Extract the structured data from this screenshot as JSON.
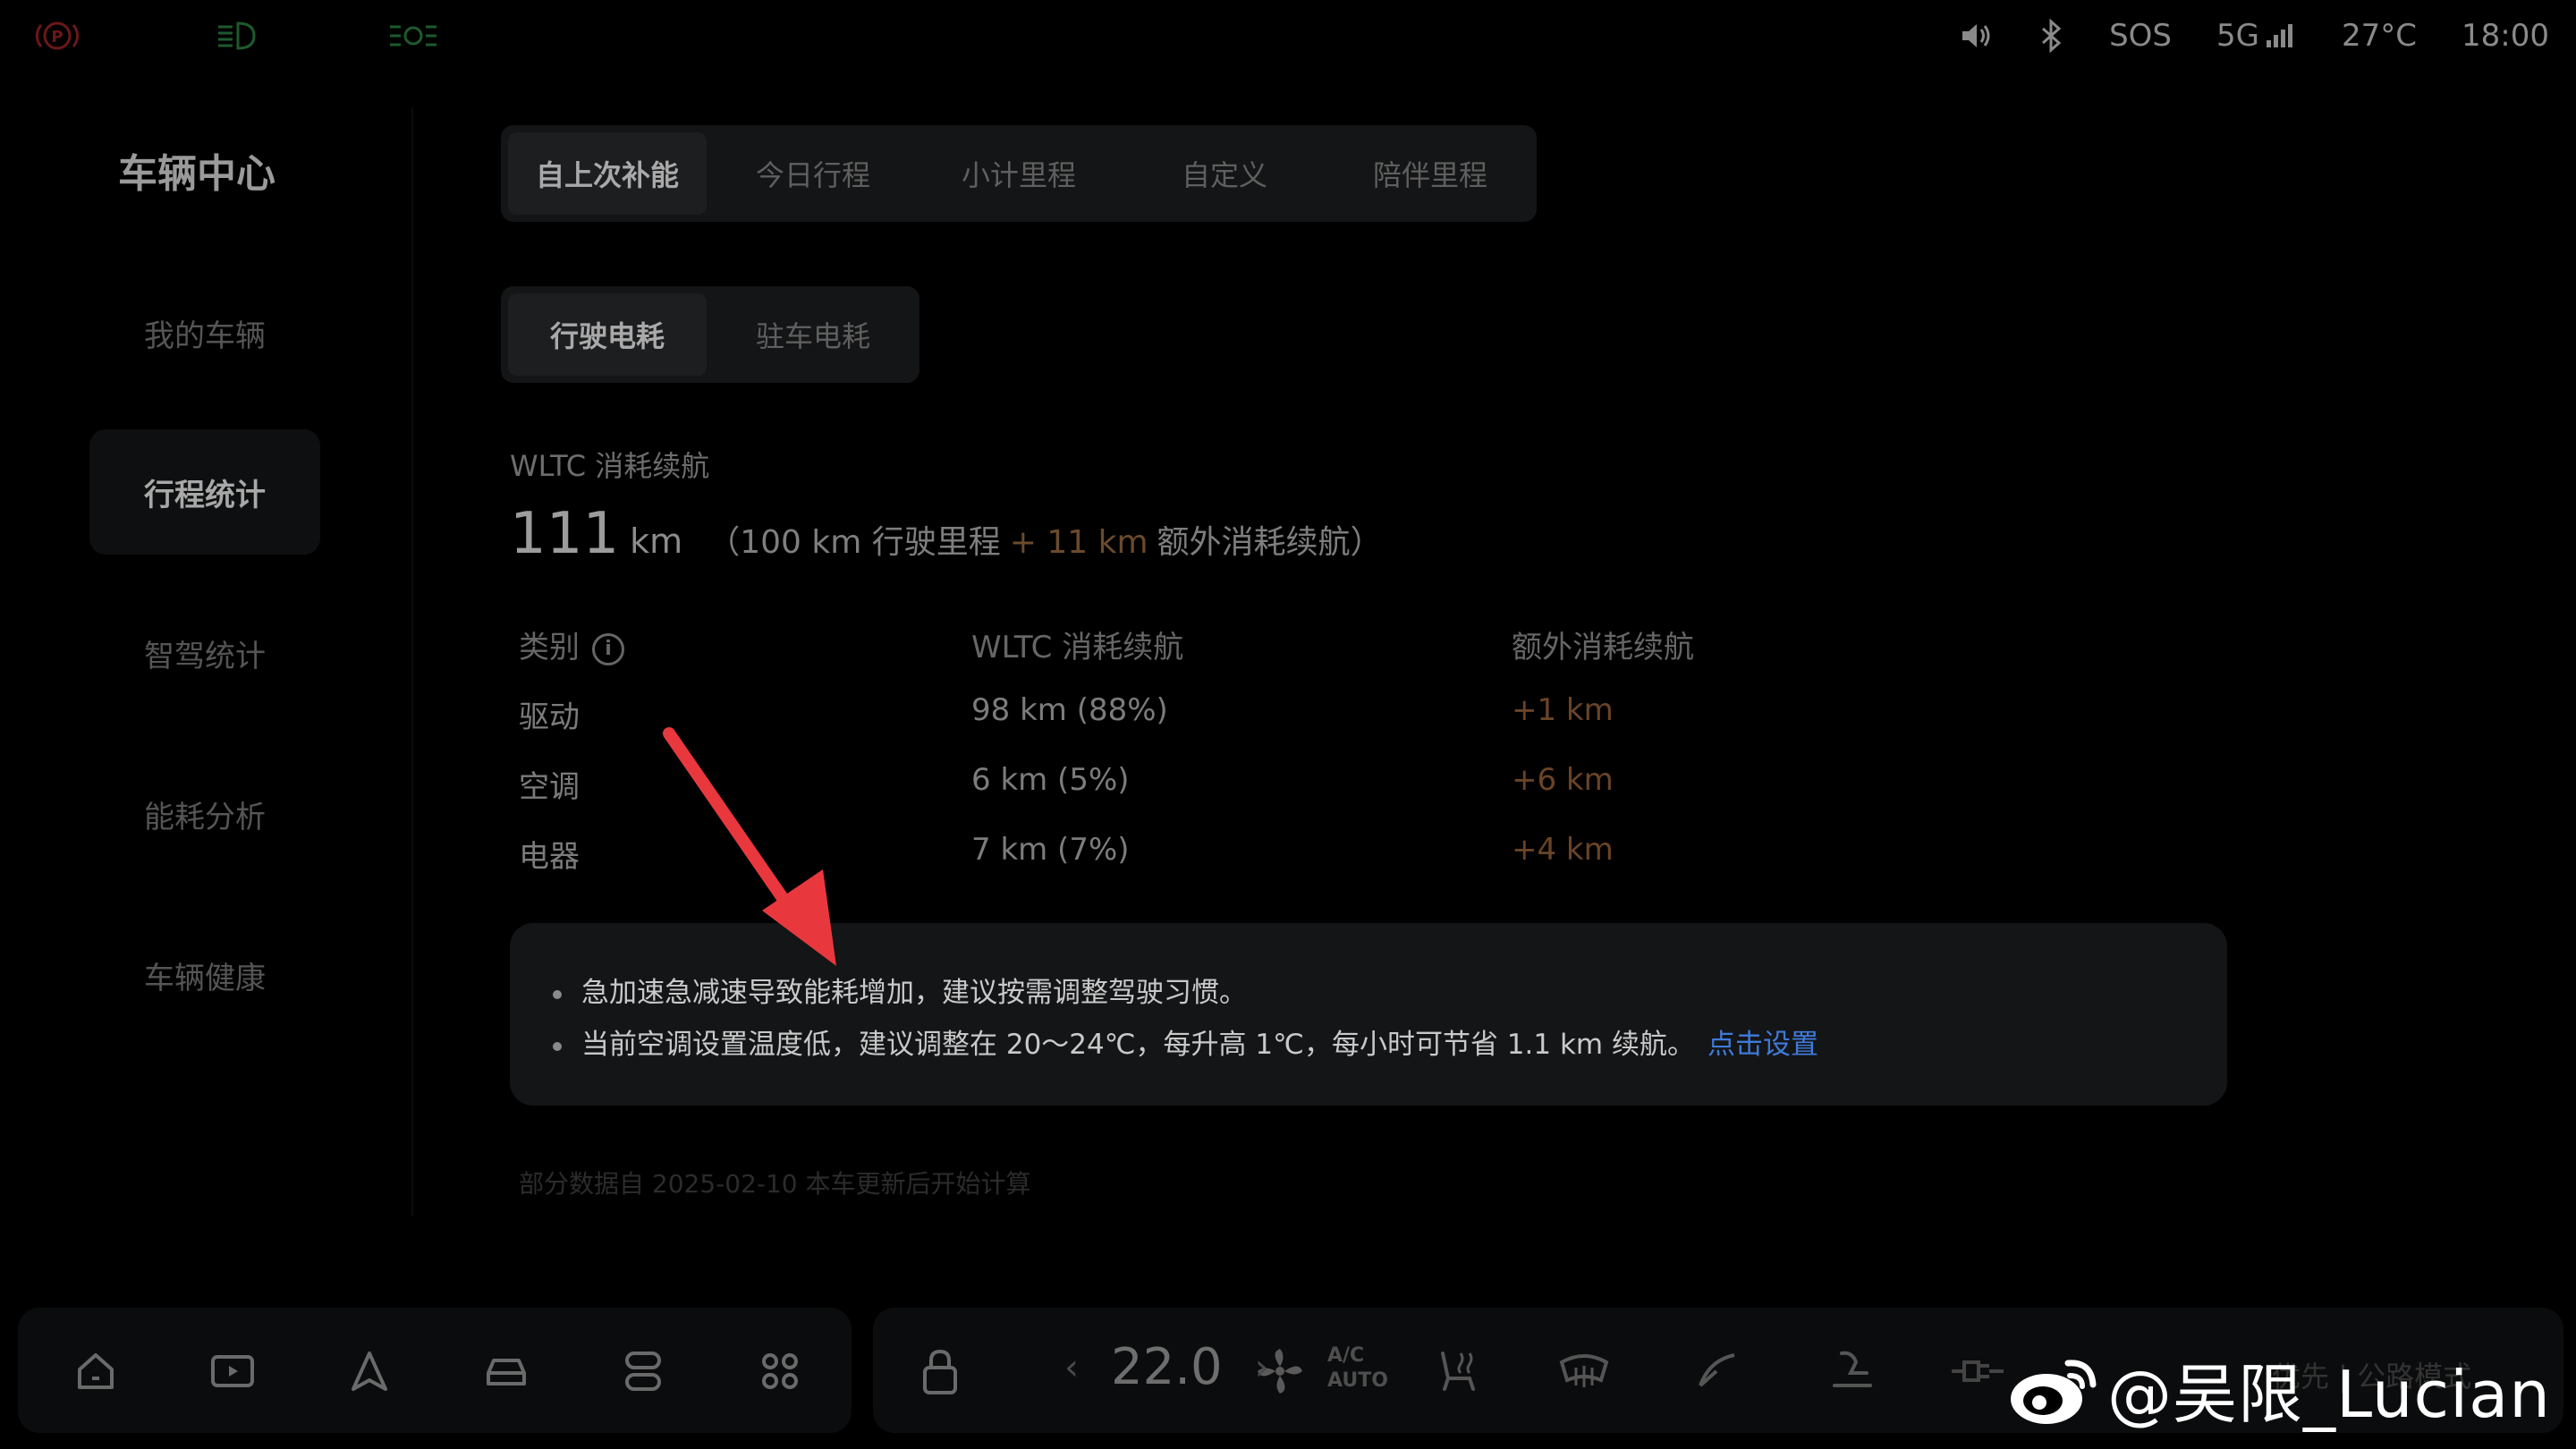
{
  "status_bar": {
    "left_icons": [
      "parking-brake-icon",
      "low-beam-icon",
      "position-lights-icon"
    ],
    "sos": "SOS",
    "network": "5G",
    "temperature": "27°C",
    "time": "18:00",
    "colors": {
      "parking": "#6b1818",
      "lights": "#1e5a2c"
    }
  },
  "sidebar": {
    "title": "车辆中心",
    "items": [
      {
        "label": "我的车辆"
      },
      {
        "label": "行程统计",
        "active": true
      },
      {
        "label": "智驾统计"
      },
      {
        "label": "能耗分析"
      },
      {
        "label": "车辆健康"
      }
    ]
  },
  "tabs_primary": [
    {
      "label": "自上次补能",
      "active": true
    },
    {
      "label": "今日行程"
    },
    {
      "label": "小计里程"
    },
    {
      "label": "自定义"
    },
    {
      "label": "陪伴里程"
    }
  ],
  "tabs_secondary": [
    {
      "label": "行驶电耗",
      "active": true
    },
    {
      "label": "驻车电耗"
    }
  ],
  "summary": {
    "label": "WLTC 消耗续航",
    "value": "111",
    "unit": "km",
    "paren_open": "（",
    "driven": "100 km 行驶里程",
    "plus": "+ 11 km",
    "extra_label": "额外消耗续航",
    "paren_close": "）"
  },
  "table": {
    "headers": [
      "类别",
      "WLTC 消耗续航",
      "额外消耗续航"
    ],
    "info_icon": "i",
    "rows": [
      {
        "category": "驱动",
        "wltc": "98 km (88%)",
        "extra": "+1 km"
      },
      {
        "category": "空调",
        "wltc": "6 km (5%)",
        "extra": "+6 km"
      },
      {
        "category": "电器",
        "wltc": "7 km (7%)",
        "extra": "+4 km"
      }
    ]
  },
  "tips": [
    {
      "text": "急加速急减速导致能耗增加，建议按需调整驾驶习惯。"
    },
    {
      "text": "当前空调设置温度低，建议调整在 20～24℃，每升高 1℃，每小时可节省 1.1 km 续航。",
      "link": "点击设置"
    }
  ],
  "footnote": "部分数据自 2025-02-10 本车更新后开始计算",
  "dock": {
    "temperature": "22.0",
    "arrow_left": "‹",
    "arrow_right": "›",
    "ac": "A/C",
    "auto": "AUTO",
    "tail_text": "优先  |  公路模式"
  },
  "watermark": {
    "text": "@吴限_Lucian"
  }
}
